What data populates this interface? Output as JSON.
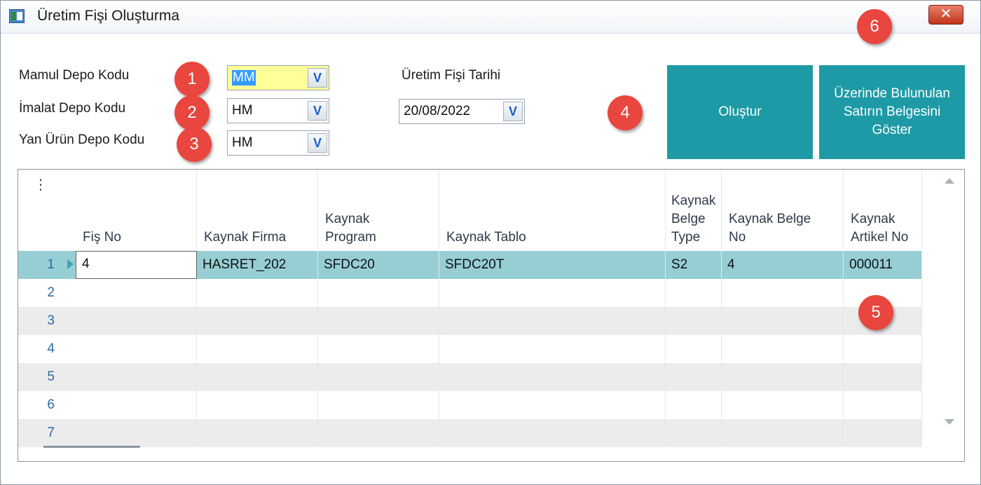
{
  "window": {
    "title": "Üretim Fişi Oluşturma",
    "close_label": "✕"
  },
  "form": {
    "mamul_label": "Mamul Depo Kodu",
    "mamul_value": "MM",
    "imalat_label": "İmalat Depo Kodu",
    "imalat_value": "HM",
    "yan_label": "Yan Ürün Depo Kodu",
    "yan_value": "HM",
    "tarih_label": "Üretim Fişi Tarihi",
    "tarih_value": "20/08/2022",
    "dropdown_glyph": "V"
  },
  "buttons": {
    "olustur": "Oluştur",
    "goster_line1": "Üzerinde Bulunulan",
    "goster_line2": "Satırın Belgesini",
    "goster_line3": "Göster"
  },
  "callouts": [
    "1",
    "2",
    "3",
    "4",
    "5",
    "6"
  ],
  "grid": {
    "menu_glyph": "⋮",
    "headers": [
      [
        "Fiş No"
      ],
      [
        "Kaynak Firma"
      ],
      [
        "Kaynak",
        "Program"
      ],
      [
        "Kaynak Tablo"
      ],
      [
        "Kaynak",
        "Belge",
        "Type"
      ],
      [
        "Kaynak Belge",
        "No"
      ],
      [
        "Kaynak",
        "Artikel No"
      ]
    ],
    "rows": [
      {
        "num": "1",
        "cells": [
          "4",
          "HASRET_202",
          "SFDC20",
          "SFDC20T",
          "S2",
          "4",
          "000011"
        ]
      },
      {
        "num": "2",
        "cells": [
          "",
          "",
          "",
          "",
          "",
          "",
          ""
        ]
      },
      {
        "num": "3",
        "cells": [
          "",
          "",
          "",
          "",
          "",
          "",
          ""
        ]
      },
      {
        "num": "4",
        "cells": [
          "",
          "",
          "",
          "",
          "",
          "",
          ""
        ]
      },
      {
        "num": "5",
        "cells": [
          "",
          "",
          "",
          "",
          "",
          "",
          ""
        ]
      },
      {
        "num": "6",
        "cells": [
          "",
          "",
          "",
          "",
          "",
          "",
          ""
        ]
      },
      {
        "num": "7",
        "cells": [
          "",
          "",
          "",
          "",
          "",
          "",
          ""
        ]
      }
    ]
  },
  "colors": {
    "accent_button": "#1e9aa6",
    "selected_row": "#96ced4",
    "callout": "#e8463e",
    "highlight_field": "#ffff99"
  }
}
